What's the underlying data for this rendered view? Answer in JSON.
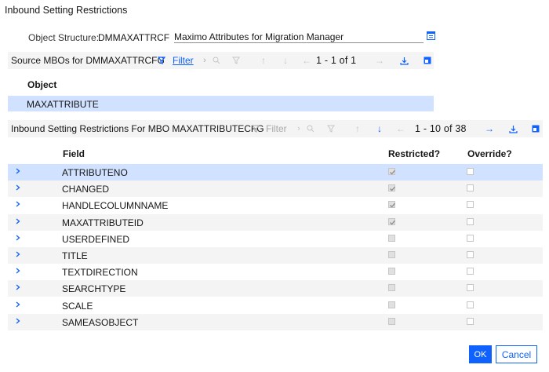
{
  "dialog": {
    "title": "Inbound Setting Restrictions"
  },
  "object_structure": {
    "label": "Object Structure:",
    "value": "DMMAXATTRCF",
    "description": "Maximo Attributes for Migration Manager"
  },
  "source_mbos": {
    "title": "Source MBOs for DMMAXATTRCFG",
    "filter_label": "Filter",
    "pager": "1 - 1 of 1",
    "column_header": "Object",
    "rows": [
      {
        "object": "MAXATTRIBUTE"
      }
    ]
  },
  "restrictions": {
    "title": "Inbound Setting Restrictions For MBO MAXATTRIBUTECFG",
    "filter_label": "Filter",
    "pager": "1 - 10 of 38",
    "columns": {
      "field": "Field",
      "restricted": "Restricted?",
      "override": "Override?"
    },
    "rows": [
      {
        "field": "ATTRIBUTENO",
        "restricted": true,
        "override": false
      },
      {
        "field": "CHANGED",
        "restricted": true,
        "override": false
      },
      {
        "field": "HANDLECOLUMNNAME",
        "restricted": true,
        "override": false
      },
      {
        "field": "MAXATTRIBUTEID",
        "restricted": true,
        "override": false
      },
      {
        "field": "USERDEFINED",
        "restricted": false,
        "override": false
      },
      {
        "field": "TITLE",
        "restricted": false,
        "override": false
      },
      {
        "field": "TEXTDIRECTION",
        "restricted": false,
        "override": false
      },
      {
        "field": "SEARCHTYPE",
        "restricted": false,
        "override": false
      },
      {
        "field": "SCALE",
        "restricted": false,
        "override": false
      },
      {
        "field": "SAMEASOBJECT",
        "restricted": false,
        "override": false
      }
    ]
  },
  "buttons": {
    "ok": "OK",
    "cancel": "Cancel"
  },
  "icons": {
    "detail": "detail-menu-icon",
    "filter": "filter-icon",
    "search": "search-icon",
    "clear_filter": "clear-filter-icon",
    "up": "arrow-up-icon",
    "down": "arrow-down-icon",
    "prev": "previous-page-icon",
    "next": "next-page-icon",
    "download": "download-icon",
    "maximize": "maximize-icon",
    "expand": "chevron-right-icon"
  },
  "colors": {
    "accent": "#0f62fe",
    "selected_row": "#d0e2ff",
    "toolbar_bg": "#f4f4f4",
    "disabled": "#a8a8a8"
  }
}
